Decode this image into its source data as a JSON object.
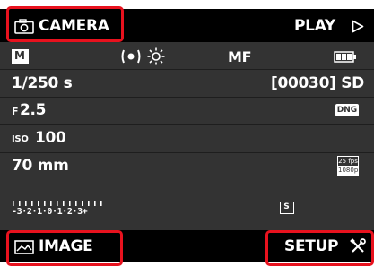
{
  "header": {
    "camera_label": "CAMERA",
    "play_label": "PLAY"
  },
  "status_row": {
    "mode_badge": "M",
    "focus_mode": "MF",
    "metering_icon": "spot-metering-icon",
    "white_balance_icon": "sun-icon",
    "battery_icon": "battery-icon"
  },
  "rows": {
    "shutter_speed": "1/250 s",
    "shots_remaining": "[00030] SD",
    "aperture_prefix": "F",
    "aperture_value": "2.5",
    "format_badge": "DNG",
    "iso_prefix": "ISO",
    "iso_value": "100",
    "focal_length": "70 mm",
    "video_badge_line1": "25 fps",
    "video_badge_line2": "1080p"
  },
  "exposure": {
    "scale_text": "-3·2·1·0·1·2·3+",
    "drive_badge": "S"
  },
  "footer": {
    "image_label": "IMAGE",
    "setup_label": "SETUP"
  },
  "colors": {
    "highlight": "#e8121e",
    "panel": "#333333",
    "bars": "#000000"
  }
}
